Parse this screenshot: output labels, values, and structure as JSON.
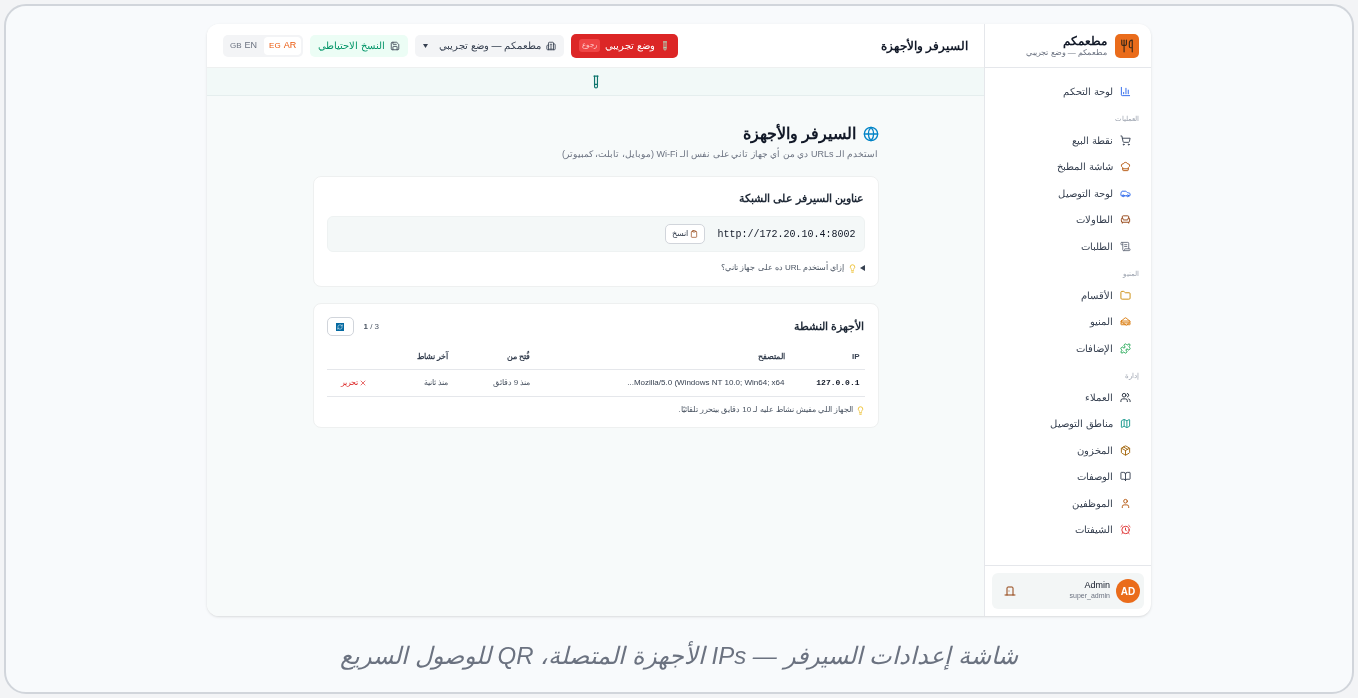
{
  "sidebar": {
    "brand": {
      "name": "مطعمكم",
      "subtitle": "مطعمكم — وضع تجريبي"
    },
    "sections": [
      {
        "items": [
          {
            "label": "لوحة التحكم",
            "selected": false
          }
        ]
      },
      {
        "heading": "العمليات",
        "items": [
          {
            "label": "نقطة البيع",
            "selected": false
          },
          {
            "label": "شاشة المطبخ",
            "selected": false
          },
          {
            "label": "لوحة التوصيل",
            "selected": false
          },
          {
            "label": "الطاولات",
            "selected": false
          },
          {
            "label": "الطلبات",
            "selected": false
          }
        ]
      },
      {
        "heading": "المنيو",
        "items": [
          {
            "label": "الأقسام",
            "selected": false
          },
          {
            "label": "المنيو",
            "selected": false
          },
          {
            "label": "الإضافات",
            "selected": false
          }
        ]
      },
      {
        "heading": "إدارة",
        "items": [
          {
            "label": "العملاء",
            "selected": false
          },
          {
            "label": "مناطق التوصيل",
            "selected": false
          },
          {
            "label": "المخزون",
            "selected": false
          },
          {
            "label": "الوصفات",
            "selected": false
          },
          {
            "label": "الموظفين",
            "selected": false
          },
          {
            "label": "الشيفتات",
            "selected": false
          }
        ]
      }
    ],
    "user": {
      "initials": "AD",
      "name": "Admin",
      "role": "super_admin"
    }
  },
  "header": {
    "title": "السيرفر والأجهزة",
    "demo_button": "وضع تجريبي",
    "demo_badge": "رجوع",
    "restaurant_select": "مطعمكم — وضع تجريبي",
    "backup_button": "النسخ الاحتياطي",
    "languages": [
      {
        "flag": "EG",
        "label": "AR",
        "selected": true
      },
      {
        "flag": "GB",
        "label": "EN",
        "selected": false
      }
    ]
  },
  "page": {
    "title": "السيرفر والأجهزة",
    "subtitle": "استخدم الـ URLs دي من أي جهاز تاني على نفس الـ Wi-Fi (موبايل، تابلت، كمبيوتر)",
    "addresses": {
      "title": "عناوين السيرفر على الشبكة",
      "urls": [
        {
          "url": "http://172.20.10.4:8002",
          "copy": "انسخ"
        }
      ],
      "help": "إزاي أستخدم URL ده على جهاز تاني؟"
    },
    "devices": {
      "title": "الأجهزة النشطة",
      "count": "**1** / 3",
      "columns": [
        "IP",
        "المتصفح",
        "فُتح من",
        "آخر نشاط"
      ],
      "rows": [
        {
          "ip": "127.0.0.1",
          "browser": "Mozilla/5.0 (Windows NT 10.0; Win64; x64...",
          "opened": "منذ 9 دقائق",
          "last": "منذ ثانية",
          "action": "تحرير"
        }
      ],
      "note": "الجهاز اللي مفيش نشاط عليه لـ 10 دقايق بيتحرر تلقائيًا."
    }
  },
  "caption": "شاشة إعدادات السيرفر — IPs الأجهزة المتصلة، QR للوصول السريع"
}
